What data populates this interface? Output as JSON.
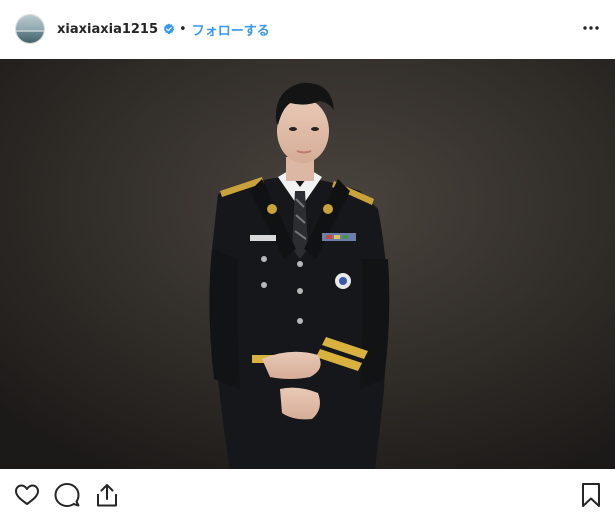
{
  "header": {
    "username": "xiaxiaxia1215",
    "separator": "•",
    "follow_label": "フォローする",
    "verified_icon": "verified-badge-icon",
    "more_icon": "more-options-icon"
  },
  "photo": {
    "subject": "person-in-dark-uniform-portrait"
  },
  "actions": {
    "like_icon": "heart-icon",
    "comment_icon": "comment-icon",
    "share_icon": "share-icon",
    "save_icon": "bookmark-icon"
  },
  "colors": {
    "link_blue": "#3897f0",
    "text": "#262626",
    "photo_bg": "#2e2a26"
  }
}
